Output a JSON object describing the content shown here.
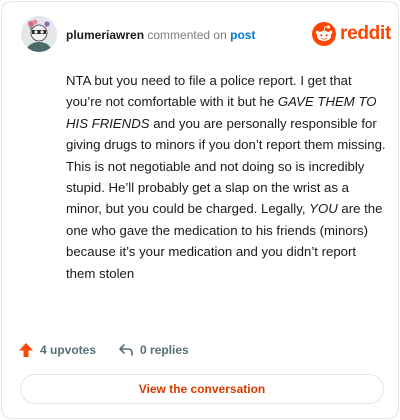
{
  "comment": {
    "username": "plumeriawren",
    "action_text": "commented on",
    "post_link": "post",
    "body_parts": [
      "NTA but you need to file a police report. I get that you’re not comfortable with it but he ",
      "GAVE THEM TO HIS FRIENDS",
      " and you are personally responsible for giving drugs to minors if you don’t report them missing. This is not negotiable and not doing so is incredibly stupid. He’ll probably get a slap on the wrist as a minor, but you could be charged. Legally, ",
      "YOU",
      " are the one who gave the medication to his friends (minors) because it’s your medication and you didn’t report them stolen"
    ]
  },
  "brand": {
    "name": "reddit",
    "color": "#ff4500"
  },
  "actions": {
    "upvotes": "4 upvotes",
    "replies": "0 replies"
  },
  "view_button": {
    "label": "View the conversation"
  },
  "colors": {
    "accent": "#ff4500",
    "link": "#0079d3",
    "button_text": "#d93a00"
  }
}
